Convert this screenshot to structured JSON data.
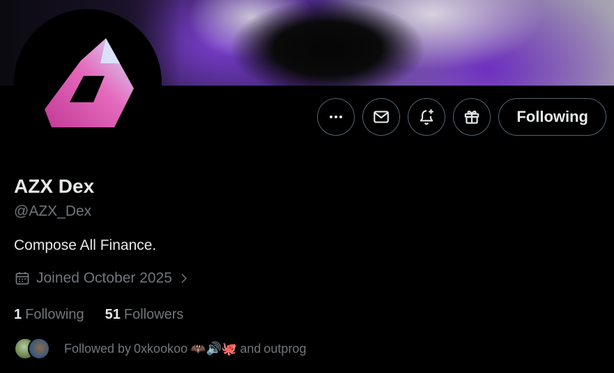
{
  "profile": {
    "name": "AZX Dex",
    "handle": "@AZX_Dex",
    "bio": "Compose All Finance.",
    "joined": "Joined October 2025",
    "following_count": "1",
    "following_label": "Following",
    "followers_count": "51",
    "followers_label": "Followers"
  },
  "actions": {
    "more_icon": "more-icon",
    "message_icon": "mail-icon",
    "notify_icon": "bell-plus-icon",
    "gift_icon": "gift-icon",
    "follow_label": "Following"
  },
  "followed_by": {
    "prefix": "Followed by",
    "user1": "0xkookoo",
    "emojis": "🦇🔊🐙",
    "connector": "and",
    "user2": "outprog"
  },
  "colors": {
    "background": "#000000",
    "text_primary": "#e7e9ea",
    "text_secondary": "#71767b",
    "border": "#536471",
    "logo_pink": "#d63fa3",
    "logo_blue": "#b9d6f5"
  }
}
